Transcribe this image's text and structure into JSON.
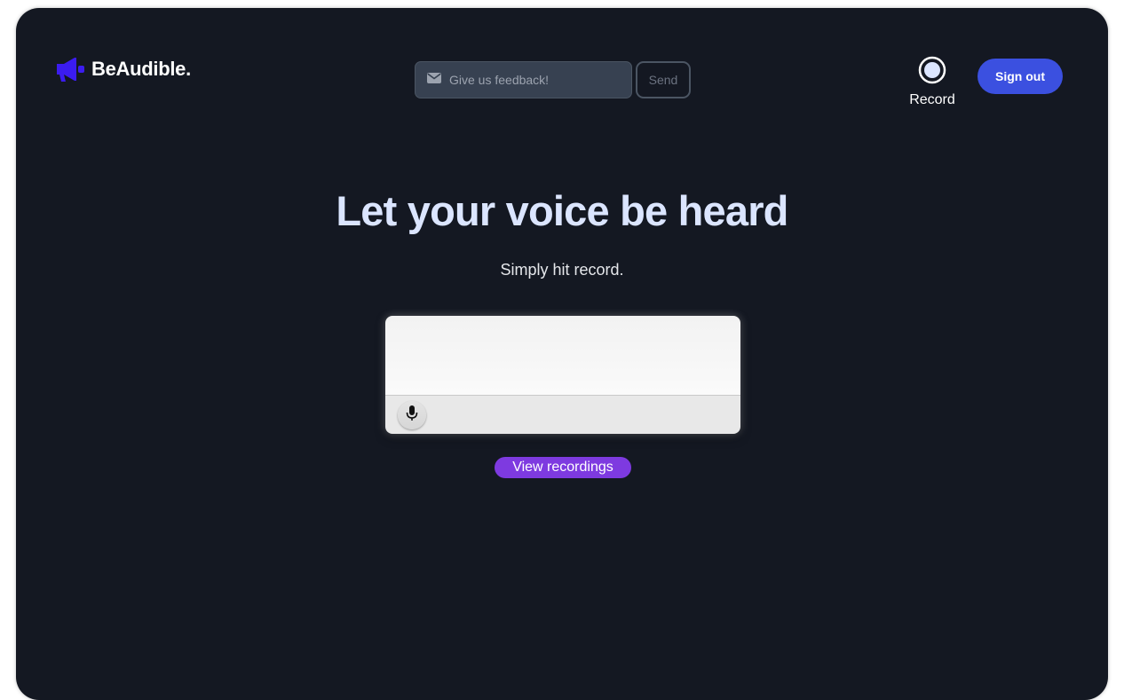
{
  "app": {
    "brand_name": "BeAudible.",
    "logo_icon": "megaphone-icon",
    "brand_color": "#3b1cf0"
  },
  "header": {
    "feedback_placeholder": "Give us feedback!",
    "feedback_icon": "envelope-icon",
    "send_label": "Send",
    "record_label": "Record",
    "record_icon": "record-circle-icon",
    "signout_label": "Sign out",
    "signout_color": "#3b50e0"
  },
  "hero": {
    "title": "Let your voice be heard",
    "subtitle": "Simply hit record."
  },
  "recorder": {
    "mic_icon": "microphone-icon"
  },
  "actions": {
    "view_recordings_label": "View recordings",
    "view_recordings_color": "#7e3ae0"
  }
}
